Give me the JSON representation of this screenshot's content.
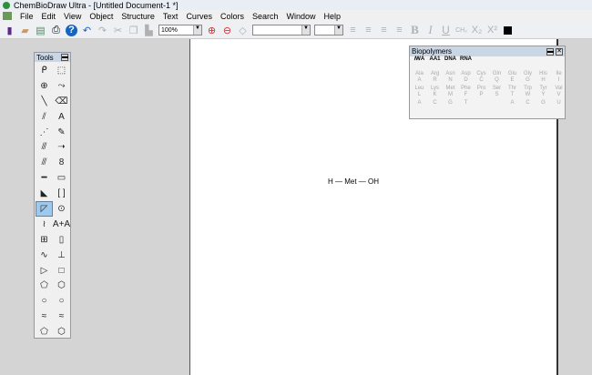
{
  "window": {
    "title": "ChemBioDraw Ultra - [Untitled Document-1 *]"
  },
  "menu": [
    "File",
    "Edit",
    "View",
    "Object",
    "Structure",
    "Text",
    "Curves",
    "Colors",
    "Search",
    "Window",
    "Help"
  ],
  "toolbar": {
    "zoom": "100%",
    "bold": "B",
    "italic": "I",
    "underline": "U",
    "formula": "CH₂",
    "subscript": "X₂",
    "superscript": "X²"
  },
  "tools": {
    "title": "Tools",
    "items": [
      "lasso-icon",
      "marquee-icon",
      "mass-fragment-icon",
      "bond-reaction-icon",
      "single-bond-icon",
      "eraser-icon",
      "double-bond-icon",
      "text-icon",
      "dashed-bond-icon",
      "pen-icon",
      "hashed-bond-icon",
      "arrow-icon",
      "hashed-wedge-icon",
      "orbital-icon",
      "bold-bond-icon",
      "drawing-elements-icon",
      "wedge-bond-icon",
      "brackets-icon",
      "hollow-wedge-icon",
      "chemical-symbols-icon",
      "wavy-bond-icon",
      "query-icon",
      "table-icon",
      "tlc-icon",
      "chain-icon",
      "template-icon",
      "triangle-icon",
      "square-icon",
      "pentagon-icon",
      "hexagon-icon",
      "heptagon-icon",
      "octagon-icon",
      "chair-icon",
      "chair2-icon",
      "cyclopentadiene-icon",
      "benzene-icon"
    ],
    "glyphs": [
      "ᑭ",
      "⬚",
      "⊕",
      "⤳",
      "╲",
      "⌫",
      "⫽",
      "A",
      "⋰",
      "✎",
      "⫻",
      "➝",
      "⫻",
      "8",
      "━",
      "▭",
      "◣",
      "[ ]",
      "◸",
      "⊙",
      "≀",
      "A+A",
      "⊞",
      "▯",
      "∿",
      "⊥",
      "▷",
      "□",
      "⬠",
      "⬡",
      "○",
      "○",
      "≈",
      "≈",
      "⬠",
      "⬡"
    ],
    "selected": 18
  },
  "molecule": "H — Met — OH",
  "biopolymers": {
    "title": "Biopolymers",
    "top": [
      "ꟿA",
      "AA1",
      "DNA",
      "RNA",
      "",
      "",
      "",
      "",
      "",
      ""
    ],
    "aa_names": [
      "Ala",
      "Arg",
      "Asn",
      "Asp",
      "Cys",
      "Gln",
      "Glu",
      "Gly",
      "His",
      "Ile",
      "Leu",
      "Lys",
      "Met",
      "Phe",
      "Pro",
      "Ser",
      "Thr",
      "Trp",
      "Tyr",
      "Val"
    ],
    "aa_codes": [
      "A",
      "R",
      "N",
      "D",
      "C",
      "Q",
      "E",
      "G",
      "H",
      "I",
      "L",
      "K",
      "M",
      "F",
      "P",
      "S",
      "T",
      "W",
      "Y",
      "V"
    ],
    "nucleotides": [
      "A",
      "C",
      "G",
      "T",
      "",
      "",
      "A",
      "C",
      "G",
      "U"
    ]
  }
}
